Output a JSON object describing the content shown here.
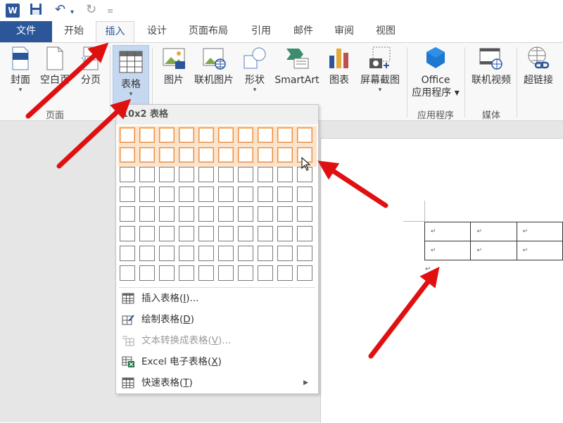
{
  "app": {
    "word_icon": "W",
    "quick_access": [
      "save-icon",
      "undo-icon",
      "undo-dropdown-icon",
      "redo-icon",
      "customize-icon"
    ]
  },
  "tabs": {
    "file": "文件",
    "home": "开始",
    "insert": "插入",
    "design": "设计",
    "layout": "页面布局",
    "references": "引用",
    "mailings": "邮件",
    "review": "审阅",
    "view": "视图"
  },
  "ribbon": {
    "pages": {
      "cover": "封面",
      "blank": "空白页",
      "break": "分页",
      "group": "页面"
    },
    "table": {
      "label": "表格"
    },
    "illustrations": {
      "pictures": "图片",
      "online_pictures": "联机图片",
      "shapes": "形状",
      "smartart": "SmartArt",
      "chart": "图表",
      "screenshot": "屏幕截图"
    },
    "apps": {
      "office_line1": "Office",
      "office_line2": "应用程序",
      "group": "应用程序"
    },
    "media": {
      "online_video": "联机视频",
      "group": "媒体"
    },
    "links": {
      "hyperlink": "超链接"
    }
  },
  "table_dropdown": {
    "header": "10x2 表格",
    "grid_cols": 10,
    "grid_rows": 8,
    "selected_cols": 10,
    "selected_rows": 2,
    "items": [
      {
        "pre": "插入表格(",
        "key": "I",
        "post": ")...",
        "disabled": false
      },
      {
        "pre": "绘制表格(",
        "key": "D",
        "post": ")",
        "disabled": false
      },
      {
        "pre": "文本转换成表格(",
        "key": "V",
        "post": ")...",
        "disabled": true
      },
      {
        "pre": "Excel 电子表格(",
        "key": "X",
        "post": ")",
        "disabled": false
      },
      {
        "pre": "快速表格(",
        "key": "T",
        "post": ")",
        "disabled": false
      }
    ]
  },
  "document": {
    "cell_mark": "↵",
    "para_mark": "↵"
  },
  "colors": {
    "brand": "#2b579a",
    "highlight_border": "#e8914a",
    "arrow": "#e01010"
  }
}
